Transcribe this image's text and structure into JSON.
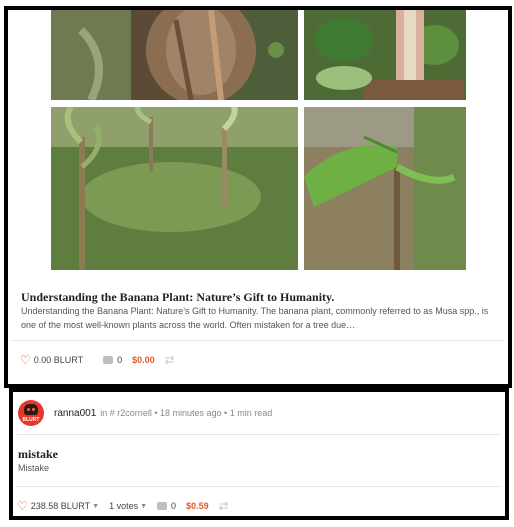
{
  "post1": {
    "title": "Understanding the Banana Plant: Nature’s Gift to Humanity.",
    "excerpt": "Understanding the Banana Plant: Nature’s Gift to Humanity. The banana plant, commonly referred to as Musa spp., is one of the most well-known plants across the world. Often mistaken for a tree due…",
    "votes_value": "0.00 BLURT",
    "comments": "0",
    "payout": "$0.00"
  },
  "post2": {
    "author": "ranna001",
    "in_label": "in",
    "community": "# r2cornell",
    "time_ago": "18 minutes ago",
    "read_time": "1 min read",
    "title": "mistake",
    "body": "Mistake",
    "votes_value": "238.58 BLURT",
    "votes_count": "1 votes",
    "comments": "0",
    "payout": "$0.59",
    "avatar_text": "BLURT"
  },
  "colors": {
    "accent": "#e05a2b",
    "avatar_bg": "#e5382b",
    "frame": "#000000"
  },
  "icons": {
    "vote": "heart-icon",
    "comment": "comment-icon",
    "reblog": "reblog-icon",
    "dropdown": "caret-down-icon"
  }
}
